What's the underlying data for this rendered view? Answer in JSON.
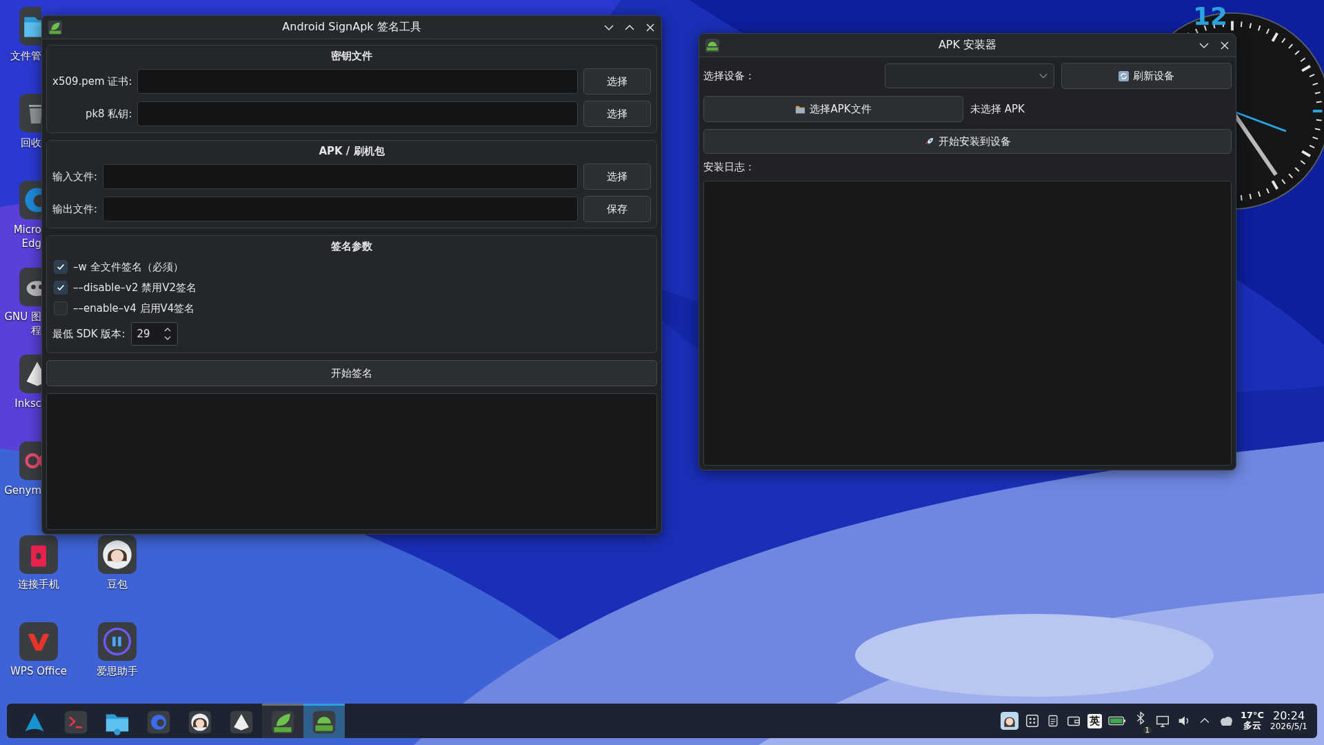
{
  "desktop": {
    "column_1": [
      {
        "label": "文件管"
      },
      {
        "label": "回收"
      },
      {
        "label": "Micro\nEdg"
      },
      {
        "label": "GNU 图程"
      },
      {
        "label": "Inksc"
      },
      {
        "label": "Genym"
      },
      {
        "label": "连接手机"
      },
      {
        "label": "WPS Office"
      }
    ],
    "column_2": [
      {
        "label": "豆包"
      },
      {
        "label": "爱思助手"
      }
    ]
  },
  "clock": {
    "numeral": "12"
  },
  "sign_window": {
    "title": "Android SignApk 签名工具",
    "key_files": {
      "title": "密钥文件",
      "rows": [
        {
          "label": "x509.pem 证书:",
          "button": "选择"
        },
        {
          "label": "pk8 私钥:",
          "button": "选择"
        }
      ]
    },
    "apk_package": {
      "title": "APK / 刷机包",
      "rows": [
        {
          "label": "输入文件:",
          "button": "选择"
        },
        {
          "label": "输出文件:",
          "button": "保存"
        }
      ]
    },
    "sign_params": {
      "title": "签名参数",
      "options": [
        {
          "label": "–w 全文件签名（必须）",
          "checked": true
        },
        {
          "label": "––disable–v2 禁用V2签名",
          "checked": true
        },
        {
          "label": "––enable–v4 启用V4签名",
          "checked": false
        }
      ],
      "min_sdk": {
        "label": "最低 SDK 版本:",
        "value": "29"
      }
    },
    "start_button": "开始签名"
  },
  "installer_window": {
    "title": "APK 安装器",
    "device_label": "选择设备：",
    "refresh_button": "刷新设备",
    "choose_button": "选择APK文件",
    "apk_status": "未选择 APK",
    "install_button": "开始安装到设备",
    "log_label": "安装日志："
  },
  "taskbar": {
    "apps": [
      {
        "open": false,
        "selected": false
      },
      {
        "open": false,
        "selected": false
      },
      {
        "open": false,
        "selected": false
      },
      {
        "open": false,
        "selected": false
      },
      {
        "open": false,
        "selected": false
      },
      {
        "open": false,
        "selected": false
      },
      {
        "open": true,
        "selected": false
      },
      {
        "open": true,
        "selected": true
      }
    ],
    "input_method": "英",
    "bluetooth_badge": "1",
    "temperature": "17°C",
    "weather": "多云",
    "time": "20:24",
    "date": "2026/5/1"
  }
}
